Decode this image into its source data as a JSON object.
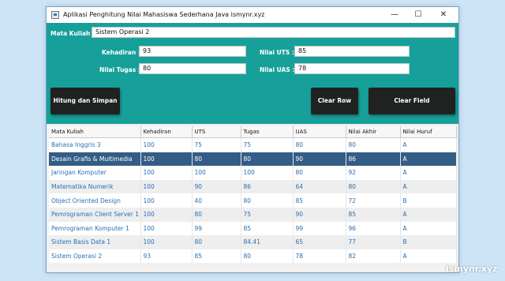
{
  "window": {
    "title": "Aplikasi Penghitung Nilai Mahasiswa Sederhana Java ismynr.xyz"
  },
  "form": {
    "mata_kuliah_label": "Mata Kuliah :",
    "mata_kuliah_value": "Sistem Operasi 2",
    "kehadiran_label": "Kehadiran :",
    "kehadiran_value": "93",
    "tugas_label": "Nilai Tugas :",
    "tugas_value": "80",
    "uts_label": "Nilai UTS :",
    "uts_value": "85",
    "uas_label": "Nilai UAS :",
    "uas_value": "78"
  },
  "buttons": {
    "hitung": "Hitung dan Simpan",
    "clear_row": "Clear Row",
    "clear_field": "Clear Field"
  },
  "table": {
    "columns": [
      "Mata Kuliah",
      "Kehadiran",
      "UTS",
      "Tugas",
      "UAS",
      "Nilai Akhir",
      "Nilai Huruf"
    ],
    "rows": [
      [
        "Bahasa Inggris 3",
        "100",
        "75",
        "75",
        "80",
        "80",
        "A"
      ],
      [
        "Desain Grafis & Multimedia",
        "100",
        "80",
        "80",
        "90",
        "86",
        "A"
      ],
      [
        "Jaringan Komputer",
        "100",
        "100",
        "100",
        "80",
        "92",
        "A"
      ],
      [
        "Matematika Numerik",
        "100",
        "90",
        "86",
        "64",
        "80",
        "A"
      ],
      [
        "Object Oriented Design",
        "100",
        "40",
        "80",
        "85",
        "72",
        "B"
      ],
      [
        "Pemrograman Client Server 1",
        "100",
        "80",
        "75",
        "90",
        "85",
        "A"
      ],
      [
        "Pemrograman Komputer 1",
        "100",
        "99",
        "85",
        "99",
        "96",
        "A"
      ],
      [
        "Sistem Basis Data 1",
        "100",
        "80",
        "84.41",
        "65",
        "77",
        "B"
      ],
      [
        "Sistem Operasi 2",
        "93",
        "85",
        "80",
        "78",
        "82",
        "A"
      ]
    ],
    "selected_row": 1
  },
  "watermark": "ismynr.xyz",
  "colors": {
    "panel": "#17a09a",
    "button": "#1f2221",
    "selected_row": "#335d86",
    "cell_text": "#2870b3"
  }
}
